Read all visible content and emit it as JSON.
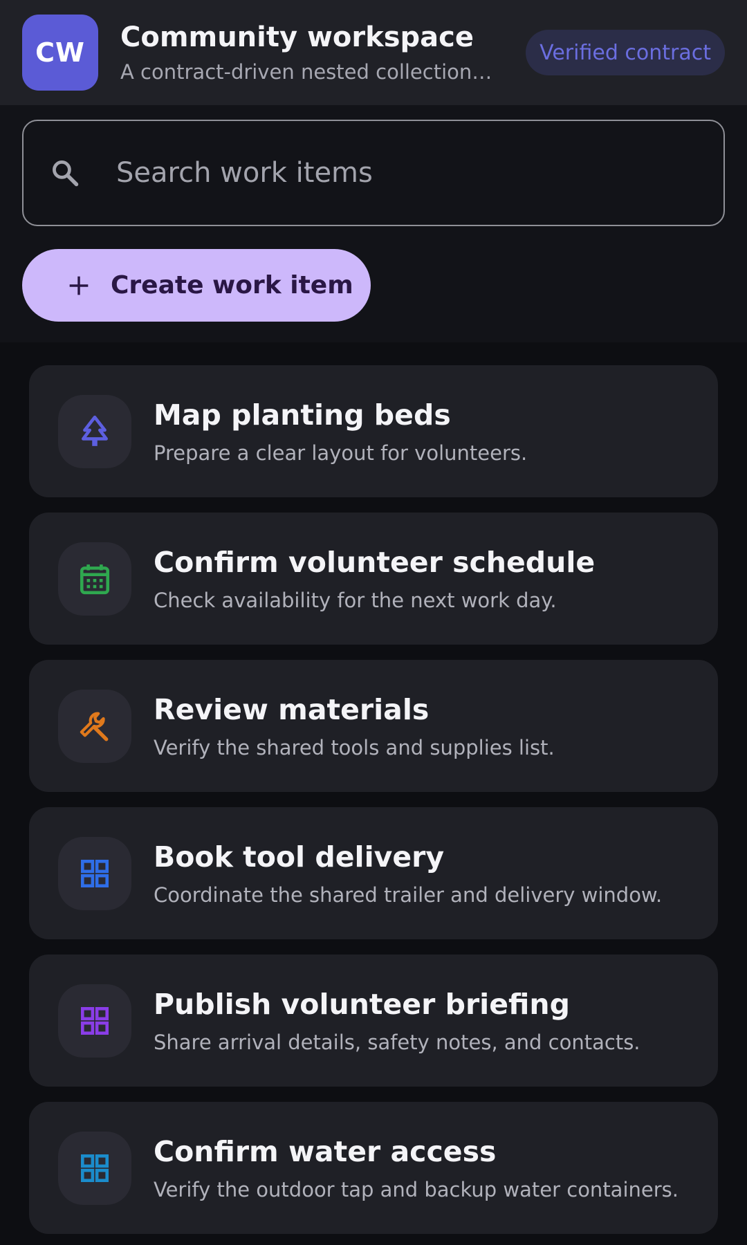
{
  "header": {
    "avatar_initials": "CW",
    "title": "Community workspace",
    "subtitle": "A contract-driven nested collection surface",
    "badge": "Verified contract"
  },
  "search": {
    "icon": "search-icon",
    "placeholder": "Search work items",
    "value": ""
  },
  "create_button": {
    "icon": "plus-icon",
    "label": "Create work item"
  },
  "items": [
    {
      "title": "Map planting beds",
      "description": "Prepare a clear layout for volunteers.",
      "icon": "tree-icon",
      "color": "#5d5fe0"
    },
    {
      "title": "Confirm volunteer schedule",
      "description": "Check availability for the next work day.",
      "icon": "calendar-icon",
      "color": "#2fa84f"
    },
    {
      "title": "Review materials",
      "description": "Verify the shared tools and supplies list.",
      "icon": "wrench-icon",
      "color": "#e0791c"
    },
    {
      "title": "Book tool delivery",
      "description": "Coordinate the shared trailer and delivery window.",
      "icon": "grid-icon",
      "color": "#2f6ee8"
    },
    {
      "title": "Publish volunteer briefing",
      "description": "Share arrival details, safety notes, and contacts.",
      "icon": "grid-icon",
      "color": "#8a3de8"
    },
    {
      "title": "Confirm water access",
      "description": "Verify the outdoor tap and backup water containers.",
      "icon": "grid-icon",
      "color": "#1b8ccc"
    }
  ],
  "colors": {
    "accent": "#5b5bd6",
    "button": "#cdb8fb",
    "badge_text": "#6b6ee0"
  }
}
